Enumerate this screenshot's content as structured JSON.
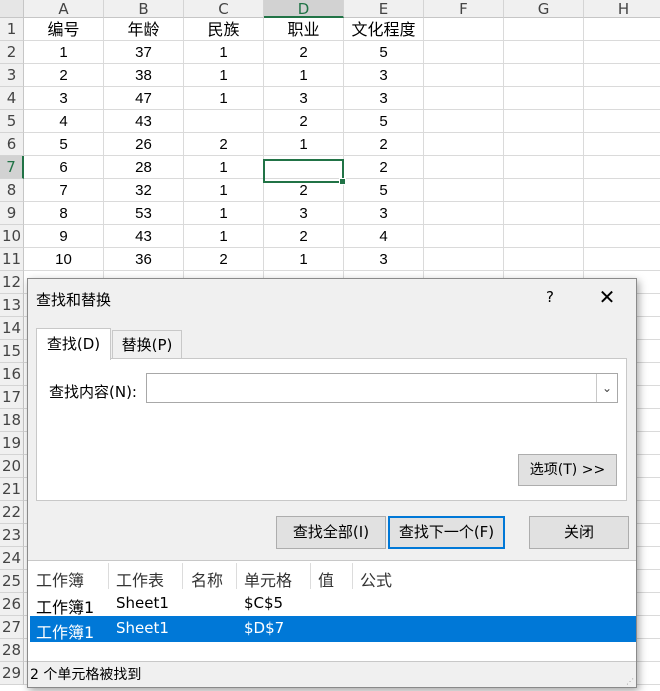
{
  "sheet": {
    "columns": [
      "A",
      "B",
      "C",
      "D",
      "E",
      "F",
      "G",
      "H"
    ],
    "selected_column": "D",
    "rows": [
      "1",
      "2",
      "3",
      "4",
      "5",
      "6",
      "7",
      "8",
      "9",
      "10",
      "11",
      "12",
      "13",
      "14",
      "15",
      "16",
      "17",
      "18",
      "19",
      "20",
      "21",
      "22",
      "23",
      "24",
      "25",
      "26",
      "27",
      "28",
      "29"
    ],
    "selected_row": "7",
    "headers": [
      "编号",
      "年龄",
      "民族",
      "职业",
      "文化程度"
    ],
    "data": [
      [
        "1",
        "37",
        "1",
        "2",
        "5"
      ],
      [
        "2",
        "38",
        "1",
        "1",
        "3"
      ],
      [
        "3",
        "47",
        "1",
        "3",
        "3"
      ],
      [
        "4",
        "43",
        "",
        "2",
        "5"
      ],
      [
        "5",
        "26",
        "2",
        "1",
        "2"
      ],
      [
        "6",
        "28",
        "1",
        "",
        "2"
      ],
      [
        "7",
        "32",
        "1",
        "2",
        "5"
      ],
      [
        "8",
        "53",
        "1",
        "3",
        "3"
      ],
      [
        "9",
        "43",
        "1",
        "2",
        "4"
      ],
      [
        "10",
        "36",
        "2",
        "1",
        "3"
      ]
    ],
    "active_cell": "D7"
  },
  "dialog": {
    "title": "查找和替换",
    "help": "?",
    "close_icon": "✕",
    "tabs": [
      {
        "label": "查找(D)",
        "active": true
      },
      {
        "label": "替换(P)",
        "active": false
      }
    ],
    "find_label": "查找内容(N):",
    "find_value": "",
    "options_button": "选项(T) >>",
    "find_all_button": "查找全部(I)",
    "find_next_button": "查找下一个(F)",
    "close_button": "关闭",
    "results": {
      "columns": [
        "工作簿",
        "工作表",
        "名称",
        "单元格",
        "值",
        "公式"
      ],
      "rows": [
        {
          "workbook": "工作簿1",
          "sheet": "Sheet1",
          "name": "",
          "cell": "$C$5",
          "value": "",
          "formula": "",
          "selected": false
        },
        {
          "workbook": "工作簿1",
          "sheet": "Sheet1",
          "name": "",
          "cell": "$D$7",
          "value": "",
          "formula": "",
          "selected": true
        }
      ]
    },
    "status": "2 个单元格被找到"
  },
  "colors": {
    "accent": "#217346",
    "selection": "#0078d7"
  }
}
